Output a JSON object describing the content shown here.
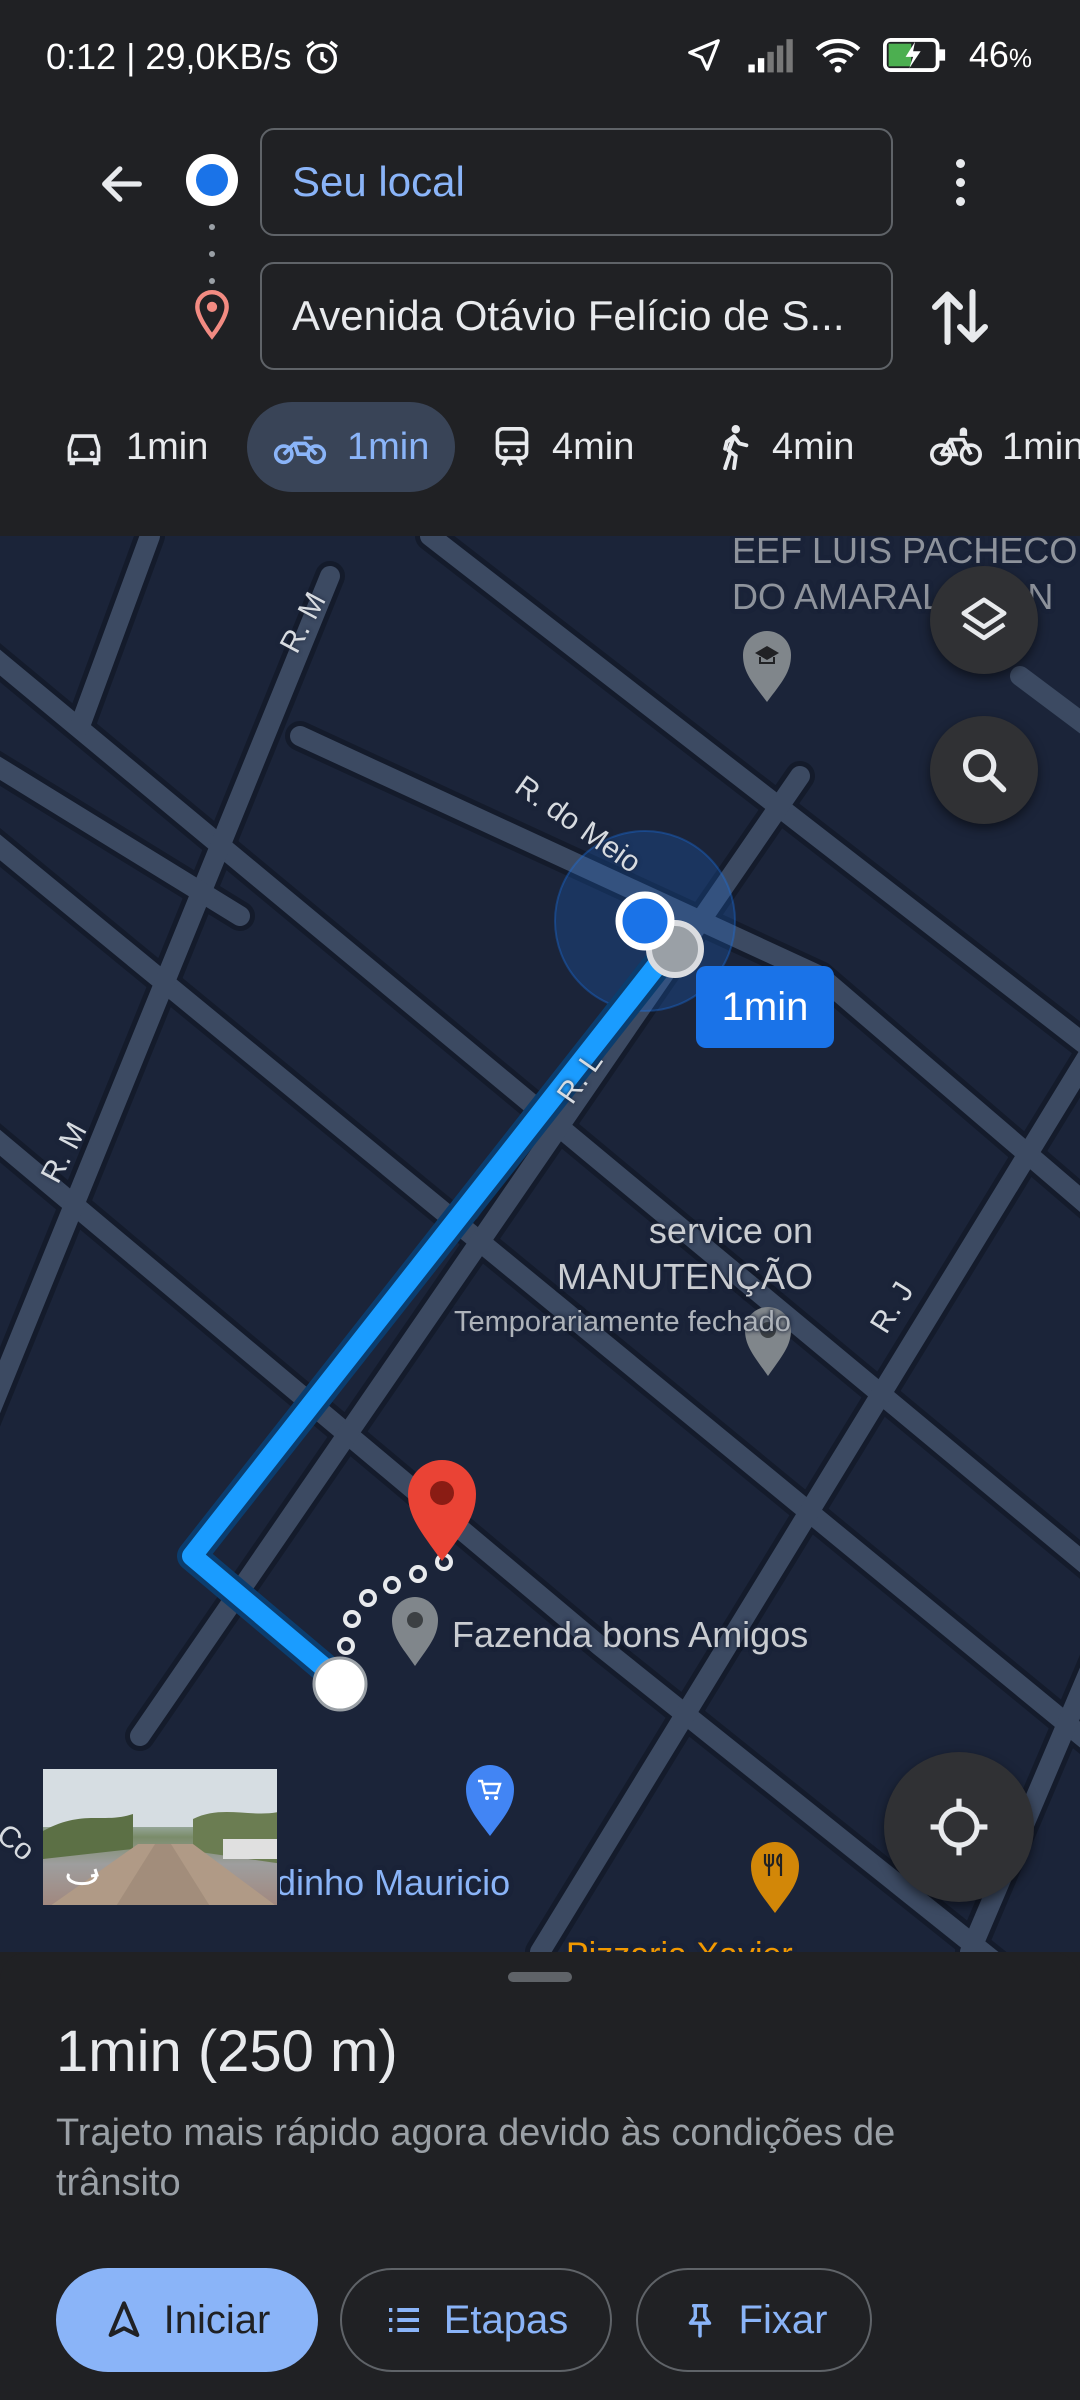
{
  "status_bar": {
    "time_speed": "0:12 | 29,0KB/s",
    "battery": "46",
    "battery_unit": "%"
  },
  "header": {
    "origin_value": "Seu local",
    "destination_value": "Avenida Otávio Felício de S..."
  },
  "modes": [
    {
      "icon": "car-icon",
      "label": "1min"
    },
    {
      "icon": "motorcycle-icon",
      "label": "1min",
      "active": true
    },
    {
      "icon": "transit-icon",
      "label": "4min"
    },
    {
      "icon": "walk-icon",
      "label": "4min"
    },
    {
      "icon": "bike-icon",
      "label": "1min"
    }
  ],
  "map": {
    "labels": {
      "school": "EEF LUIS PACHECO DO AMARAL TIPAN",
      "school_line1": "EEF LUIS PACHECO",
      "school_line2": "DO AMARAL TIPAN",
      "service_line1": "service on",
      "service_line2": "MANUTENÇÃO",
      "service_status": "Temporariamente fechado",
      "farm": "Fazenda bons Amigos",
      "shop": "dinho Mauricio",
      "bottom_partial": "Pizzaria Xavier"
    },
    "roads": {
      "r_do_meio": "R. do Meio",
      "r_m_top": "R. M",
      "r_m_left": "R. M",
      "r_l": "R. L",
      "r_j": "R. J",
      "co": "Co"
    },
    "eta_badge": "1min"
  },
  "sheet": {
    "summary": "1min (250 m)",
    "description": "Trajeto mais rápido agora devido às condições de trânsito",
    "start_label": "Iniciar",
    "steps_label": "Etapas",
    "pin_label": "Fixar"
  },
  "colors": {
    "route": "#1a9cff",
    "accent": "#8ab4f8",
    "badge": "#1a73e8",
    "map_bg": "#1b2439",
    "road": "#3c4a62"
  }
}
